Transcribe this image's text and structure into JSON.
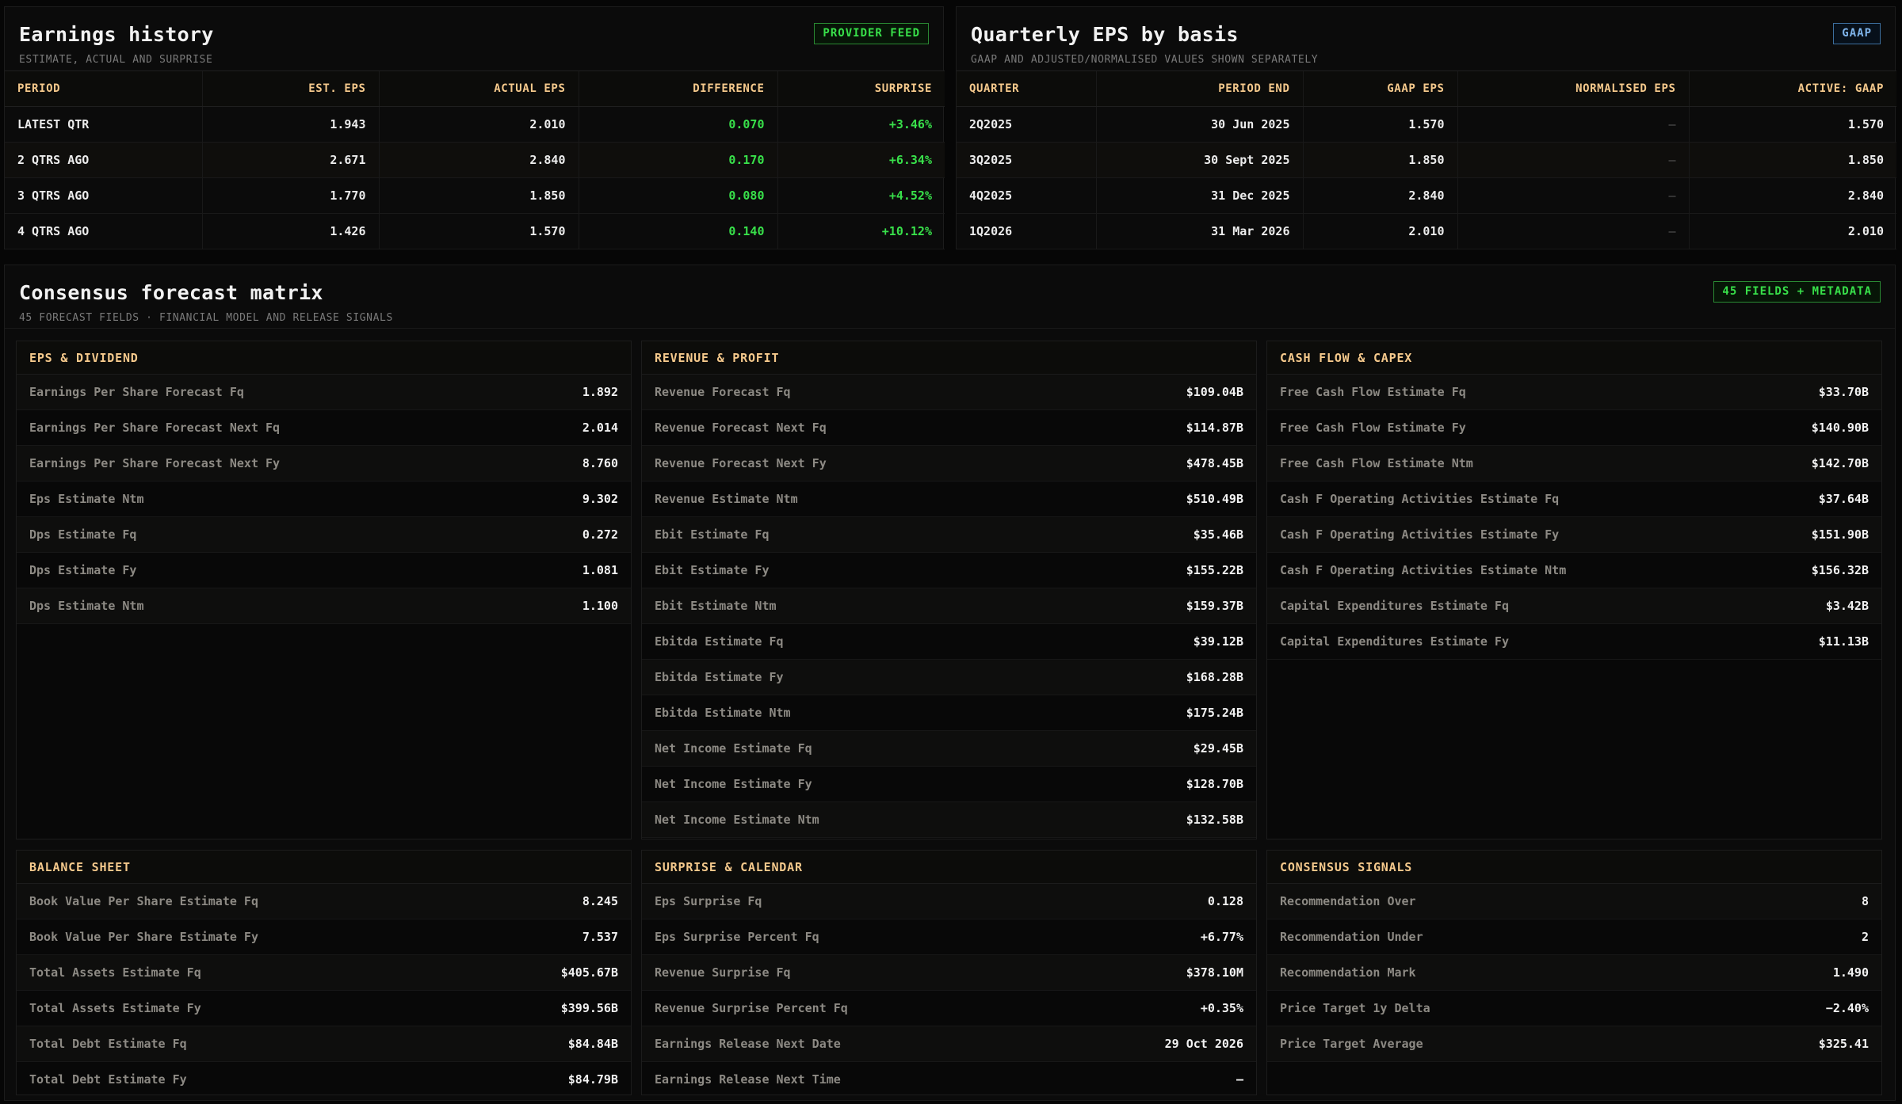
{
  "earnings_history": {
    "title": "Earnings history",
    "subtitle": "ESTIMATE, ACTUAL AND SURPRISE",
    "badge": "PROVIDER FEED",
    "columns": [
      "PERIOD",
      "EST. EPS",
      "ACTUAL EPS",
      "DIFFERENCE",
      "SURPRISE"
    ],
    "rows": [
      [
        "LATEST QTR",
        "1.943",
        "2.010",
        "0.070",
        "+3.46%"
      ],
      [
        "2 QTRS AGO",
        "2.671",
        "2.840",
        "0.170",
        "+6.34%"
      ],
      [
        "3 QTRS AGO",
        "1.770",
        "1.850",
        "0.080",
        "+4.52%"
      ],
      [
        "4 QTRS AGO",
        "1.426",
        "1.570",
        "0.140",
        "+10.12%"
      ]
    ]
  },
  "quarterly_eps": {
    "title": "Quarterly EPS by basis",
    "subtitle": "GAAP AND ADJUSTED/NORMALISED VALUES SHOWN SEPARATELY",
    "badge": "GAAP",
    "columns": [
      "QUARTER",
      "PERIOD END",
      "GAAP EPS",
      "NORMALISED EPS",
      "ACTIVE: GAAP"
    ],
    "rows": [
      [
        "2Q2025",
        "30 Jun 2025",
        "1.570",
        "—",
        "1.570"
      ],
      [
        "3Q2025",
        "30 Sept 2025",
        "1.850",
        "—",
        "1.850"
      ],
      [
        "4Q2025",
        "31 Dec 2025",
        "2.840",
        "—",
        "2.840"
      ],
      [
        "1Q2026",
        "31 Mar 2026",
        "2.010",
        "—",
        "2.010"
      ]
    ]
  },
  "consensus": {
    "title": "Consensus forecast matrix",
    "subtitle": "45 FORECAST FIELDS · FINANCIAL MODEL AND RELEASE SIGNALS",
    "badge": "45 FIELDS + METADATA",
    "sections": [
      {
        "title": "EPS & DIVIDEND",
        "rows": [
          [
            "Earnings Per Share Forecast Fq",
            "1.892"
          ],
          [
            "Earnings Per Share Forecast Next Fq",
            "2.014"
          ],
          [
            "Earnings Per Share Forecast Next Fy",
            "8.760"
          ],
          [
            "Eps Estimate Ntm",
            "9.302"
          ],
          [
            "Dps Estimate Fq",
            "0.272"
          ],
          [
            "Dps Estimate Fy",
            "1.081"
          ],
          [
            "Dps Estimate Ntm",
            "1.100"
          ]
        ]
      },
      {
        "title": "REVENUE & PROFIT",
        "rows": [
          [
            "Revenue Forecast Fq",
            "$109.04B"
          ],
          [
            "Revenue Forecast Next Fq",
            "$114.87B"
          ],
          [
            "Revenue Forecast Next Fy",
            "$478.45B"
          ],
          [
            "Revenue Estimate Ntm",
            "$510.49B"
          ],
          [
            "Ebit Estimate Fq",
            "$35.46B"
          ],
          [
            "Ebit Estimate Fy",
            "$155.22B"
          ],
          [
            "Ebit Estimate Ntm",
            "$159.37B"
          ],
          [
            "Ebitda Estimate Fq",
            "$39.12B"
          ],
          [
            "Ebitda Estimate Fy",
            "$168.28B"
          ],
          [
            "Ebitda Estimate Ntm",
            "$175.24B"
          ],
          [
            "Net Income Estimate Fq",
            "$29.45B"
          ],
          [
            "Net Income Estimate Fy",
            "$128.70B"
          ],
          [
            "Net Income Estimate Ntm",
            "$132.58B"
          ]
        ]
      },
      {
        "title": "CASH FLOW & CAPEX",
        "rows": [
          [
            "Free Cash Flow Estimate Fq",
            "$33.70B"
          ],
          [
            "Free Cash Flow Estimate Fy",
            "$140.90B"
          ],
          [
            "Free Cash Flow Estimate Ntm",
            "$142.70B"
          ],
          [
            "Cash F Operating Activities Estimate Fq",
            "$37.64B"
          ],
          [
            "Cash F Operating Activities Estimate Fy",
            "$151.90B"
          ],
          [
            "Cash F Operating Activities Estimate Ntm",
            "$156.32B"
          ],
          [
            "Capital Expenditures Estimate Fq",
            "$3.42B"
          ],
          [
            "Capital Expenditures Estimate Fy",
            "$11.13B"
          ]
        ]
      },
      {
        "title": "BALANCE SHEET",
        "rows": [
          [
            "Book Value Per Share Estimate Fq",
            "8.245"
          ],
          [
            "Book Value Per Share Estimate Fy",
            "7.537"
          ],
          [
            "Total Assets Estimate Fq",
            "$405.67B"
          ],
          [
            "Total Assets Estimate Fy",
            "$399.56B"
          ],
          [
            "Total Debt Estimate Fq",
            "$84.84B"
          ],
          [
            "Total Debt Estimate Fy",
            "$84.79B"
          ]
        ]
      },
      {
        "title": "SURPRISE & CALENDAR",
        "rows": [
          [
            "Eps Surprise Fq",
            "0.128"
          ],
          [
            "Eps Surprise Percent Fq",
            "+6.77%"
          ],
          [
            "Revenue Surprise Fq",
            "$378.10M"
          ],
          [
            "Revenue Surprise Percent Fq",
            "+0.35%"
          ],
          [
            "Earnings Release Next Date",
            "29 Oct 2026"
          ],
          [
            "Earnings Release Next Time",
            "—"
          ]
        ]
      },
      {
        "title": "CONSENSUS SIGNALS",
        "rows": [
          [
            "Recommendation Over",
            "8"
          ],
          [
            "Recommendation Under",
            "2"
          ],
          [
            "Recommendation Mark",
            "1.490"
          ],
          [
            "Price Target 1y Delta",
            "−2.40%"
          ],
          [
            "Price Target Average",
            "$325.41"
          ]
        ]
      }
    ]
  }
}
